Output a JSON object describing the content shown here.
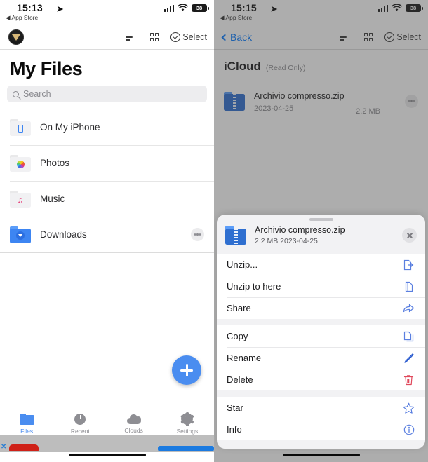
{
  "left_panel": {
    "status_bar": {
      "time": "15:13",
      "location_arrow": "location-arrow-icon",
      "back_app": "◀ App Store",
      "signal": "cellular-bars-icon",
      "wifi": "wifi-icon",
      "battery": "38"
    },
    "navbar": {
      "avatar": "user-avatar-icon",
      "sort_icon": "sort-icon",
      "grid_icon": "grid-view-icon",
      "select_label": "Select"
    },
    "title": "My Files",
    "search": {
      "placeholder": "Search",
      "value": ""
    },
    "files": [
      {
        "label": "On My iPhone",
        "icon": "folder-iphone-icon",
        "has_more": false
      },
      {
        "label": "Photos",
        "icon": "folder-photos-icon",
        "has_more": false
      },
      {
        "label": "Music",
        "icon": "folder-music-icon",
        "has_more": false
      },
      {
        "label": "Downloads",
        "icon": "folder-downloads-icon",
        "has_more": true
      }
    ],
    "fab_label": "+",
    "tabs": [
      {
        "label": "Files",
        "icon": "files-icon",
        "active": true
      },
      {
        "label": "Recent",
        "icon": "clock-icon",
        "active": false
      },
      {
        "label": "Clouds",
        "icon": "cloud-icon",
        "active": false
      },
      {
        "label": "Settings",
        "icon": "gear-icon",
        "active": false
      }
    ],
    "ad_overlay": {
      "close_label": "✕"
    }
  },
  "right_panel": {
    "status_bar": {
      "time": "15:15",
      "location_arrow": "location-arrow-icon",
      "back_app": "◀ App Store",
      "signal": "cellular-bars-icon",
      "wifi": "wifi-icon",
      "battery": "38"
    },
    "navbar": {
      "back_label": "Back",
      "sort_icon": "sort-icon",
      "grid_icon": "grid-view-icon",
      "select_label": "Select"
    },
    "title": "iCloud",
    "title_note": "(Read Only)",
    "file": {
      "name": "Archivio compresso.zip",
      "date": "2023-04-25",
      "size": "2.2 MB",
      "icon": "zip-file-icon"
    },
    "action_sheet": {
      "file_name": "Archivio compresso.zip",
      "file_meta": "2.2 MB 2023-04-25",
      "close_icon": "close-icon",
      "groups": [
        {
          "items": [
            {
              "label": "Unzip...",
              "icon": "unzip-icon",
              "color": "#5a7fe0"
            },
            {
              "label": "Unzip to here",
              "icon": "unzip-here-icon",
              "color": "#5a7fe0"
            },
            {
              "label": "Share",
              "icon": "share-icon",
              "color": "#5a7fe0"
            }
          ]
        },
        {
          "items": [
            {
              "label": "Copy",
              "icon": "copy-icon",
              "color": "#5a7fe0"
            },
            {
              "label": "Rename",
              "icon": "pencil-icon",
              "color": "#2f5fd0"
            },
            {
              "label": "Delete",
              "icon": "trash-icon",
              "color": "#e0495c"
            }
          ]
        },
        {
          "items": [
            {
              "label": "Star",
              "icon": "star-icon",
              "color": "#5a7fe0"
            },
            {
              "label": "Info",
              "icon": "info-icon",
              "color": "#5a7fe0"
            }
          ]
        }
      ]
    }
  },
  "colors": {
    "accent_blue": "#4a8df0",
    "link_blue": "#0a7cff",
    "delete_red": "#e0495c",
    "backdrop": "#949494"
  }
}
